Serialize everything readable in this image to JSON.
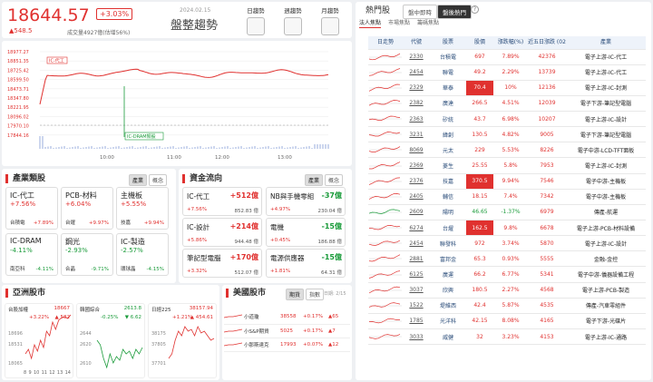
{
  "index": {
    "value": "18644.57",
    "pct": "+3.03%",
    "chg": "▲548.5",
    "vol": "成交量4927億(估增56%)",
    "date": "2024.02.15",
    "title": "盤整趨勢",
    "trend_buttons": [
      "日趨勢",
      "週趨勢",
      "月趨勢"
    ]
  },
  "intraday": {
    "tag": "IC-代工",
    "marker": "IC-DRAM類股",
    "yticks": [
      "18977.27",
      "18851.35",
      "18725.42",
      "18599.50",
      "18473.71",
      "18347.80",
      "18221.95",
      "18096.02",
      "17970.10",
      "17844.16"
    ],
    "xticks": [
      "10:00",
      "11:00",
      "12:00",
      "13:00"
    ]
  },
  "industry": {
    "title": "產業類股",
    "tabs": [
      "產業",
      "概念"
    ],
    "tiles": [
      {
        "name": "IC-代工",
        "pct": "+7.56%",
        "lead": "台積電",
        "lead_pct": "+7.89%",
        "color": "up"
      },
      {
        "name": "PCB-材料",
        "pct": "+6.04%",
        "lead": "台燿",
        "lead_pct": "+9.97%",
        "color": "up"
      },
      {
        "name": "主機板",
        "pct": "+5.55%",
        "lead": "技嘉",
        "lead_pct": "+9.94%",
        "color": "up"
      },
      {
        "name": "IC-DRAM",
        "pct": "-4.11%",
        "lead": "南亞科",
        "lead_pct": "-4.11%",
        "color": "dn"
      },
      {
        "name": "鋼光",
        "pct": "-2.93%",
        "lead": "合晶",
        "lead_pct": "-9.71%",
        "color": "dn"
      },
      {
        "name": "IC-製造",
        "pct": "-2.57%",
        "lead": "環球晶",
        "lead_pct": "-4.15%",
        "color": "dn"
      }
    ]
  },
  "money": {
    "title": "資金流向",
    "tabs": [
      "產業",
      "概念"
    ],
    "items": [
      {
        "name": "IC-代工",
        "val": "+512億",
        "pct": "+7.56%",
        "amt": "852.83 億",
        "color": "up"
      },
      {
        "name": "NB與手機零組",
        "val": "-37億",
        "pct": "+4.97%",
        "amt": "230.04 億",
        "color": "dn"
      },
      {
        "name": "IC-設計",
        "val": "+214億",
        "pct": "+5.86%",
        "amt": "944.48 億",
        "color": "up"
      },
      {
        "name": "電機",
        "val": "-15億",
        "pct": "+0.45%",
        "amt": "186.88 億",
        "color": "dn"
      },
      {
        "name": "筆記型電腦",
        "val": "+170億",
        "pct": "+3.32%",
        "amt": "512.07 億",
        "color": "up"
      },
      {
        "name": "電源供應器",
        "val": "-15億",
        "pct": "+1.81%",
        "amt": "64.31 億",
        "color": "dn"
      }
    ]
  },
  "asia": {
    "title": "亞洲股市",
    "charts": [
      {
        "name": "台股加權",
        "last": "18667",
        "pct": "+3.22%",
        "chg": "▲ 582",
        "ticks": [
          "18696",
          "18531",
          "18065"
        ],
        "x": [
          "8",
          "9",
          "10",
          "11",
          "12",
          "13",
          "14"
        ]
      },
      {
        "name": "韓國綜合",
        "last": "2613.8",
        "pct": "-0.25%",
        "chg": "▼ 6.62",
        "ticks": [
          "2644",
          "2620",
          "2610"
        ],
        "x": []
      },
      {
        "name": "日經225",
        "last": "38157.94",
        "pct": "+1.21%",
        "chg": "▲ 454.61",
        "ticks": [
          "38175",
          "37805",
          "37701"
        ],
        "x": []
      }
    ]
  },
  "us": {
    "title": "美國股市",
    "tabs": [
      "期貨",
      "指數"
    ],
    "date": "日期: 2/15",
    "rows": [
      {
        "name": "小道瓊",
        "last": "38558",
        "pct": "+0.17%",
        "chg": "▲65"
      },
      {
        "name": "小S&P期貨",
        "last": "5025",
        "pct": "+0.17%",
        "chg": "▲7"
      },
      {
        "name": "小那斯達克",
        "last": "17993",
        "pct": "+0.07%",
        "chg": "▲12"
      }
    ]
  },
  "hot": {
    "title": "熱門股",
    "top_tabs": [
      "盤中即時",
      "盤後熱門"
    ],
    "sub_tabs": [
      "法人焦點",
      "市場焦點",
      "籌碼焦點"
    ],
    "headers": [
      "日走勢",
      "代號",
      "股票",
      "股價",
      "漲跌幅(%)",
      "近五日漲跌\n(02/15)",
      "產業"
    ],
    "rows": [
      {
        "code": "2330",
        "name": "台積電",
        "price": "697",
        "pct": "7.89%",
        "v": "42376",
        "ind": "電子上游-IC-代工",
        "hl": false
      },
      {
        "code": "2454",
        "name": "聯電",
        "price": "49.2",
        "pct": "2.29%",
        "v": "13739",
        "ind": "電子上游-IC-代工",
        "hl": false
      },
      {
        "code": "2329",
        "name": "華泰",
        "price": "70.4",
        "pct": "10%",
        "v": "12136",
        "ind": "電子上游-IC-封測",
        "hl": true
      },
      {
        "code": "2382",
        "name": "廣達",
        "price": "266.5",
        "pct": "4.51%",
        "v": "12039",
        "ind": "電子下游-筆記型電腦",
        "hl": false
      },
      {
        "code": "2363",
        "name": "矽統",
        "price": "43.7",
        "pct": "6.98%",
        "v": "10207",
        "ind": "電子上游-IC-設計",
        "hl": false
      },
      {
        "code": "3231",
        "name": "緯創",
        "price": "130.5",
        "pct": "4.82%",
        "v": "9005",
        "ind": "電子下游-筆記型電腦",
        "hl": false
      },
      {
        "code": "8069",
        "name": "元太",
        "price": "229",
        "pct": "5.53%",
        "v": "8226",
        "ind": "電子中游-LCD-TFT面板",
        "hl": false
      },
      {
        "code": "2369",
        "name": "菱生",
        "price": "25.55",
        "pct": "5.8%",
        "v": "7953",
        "ind": "電子上游-IC-封測",
        "hl": false
      },
      {
        "code": "2376",
        "name": "技嘉",
        "price": "370.5",
        "pct": "9.94%",
        "v": "7546",
        "ind": "電子中游-主機板",
        "hl": true
      },
      {
        "code": "2405",
        "name": "輔信",
        "price": "18.15",
        "pct": "7.4%",
        "v": "7342",
        "ind": "電子中游-主機板",
        "hl": false
      },
      {
        "code": "2609",
        "name": "陽明",
        "price": "46.65",
        "pct": "-1.37%",
        "v": "6979",
        "ind": "傳產-航運",
        "hl": false
      },
      {
        "code": "6274",
        "name": "台燿",
        "price": "162.5",
        "pct": "9.8%",
        "v": "6678",
        "ind": "電子上游-PCB-材料設備",
        "hl": true
      },
      {
        "code": "2454",
        "name": "聯發科",
        "price": "972",
        "pct": "3.74%",
        "v": "5870",
        "ind": "電子上游-IC-設計",
        "hl": false
      },
      {
        "code": "2881",
        "name": "富邦金",
        "price": "65.3",
        "pct": "0.93%",
        "v": "5555",
        "ind": "金融-金控",
        "hl": false
      },
      {
        "code": "6125",
        "name": "廣運",
        "price": "66.2",
        "pct": "6.77%",
        "v": "5341",
        "ind": "電子中游-儀器設備工程",
        "hl": false
      },
      {
        "code": "3037",
        "name": "欣興",
        "price": "180.5",
        "pct": "2.27%",
        "v": "4568",
        "ind": "電子上游-PCB-製造",
        "hl": false
      },
      {
        "code": "1522",
        "name": "堤維西",
        "price": "42.4",
        "pct": "5.87%",
        "v": "4535",
        "ind": "傳產-汽車零組件",
        "hl": false
      },
      {
        "code": "1785",
        "name": "光洋科",
        "price": "42.15",
        "pct": "8.08%",
        "v": "4165",
        "ind": "電子下游-光碟片",
        "hl": false
      },
      {
        "code": "3033",
        "name": "威健",
        "price": "32",
        "pct": "3.23%",
        "v": "4153",
        "ind": "電子上游-IC-通路",
        "hl": false
      }
    ]
  },
  "colors": {
    "up": "#e0312f",
    "down": "#1a9b3a",
    "accent": "#e0312f"
  }
}
